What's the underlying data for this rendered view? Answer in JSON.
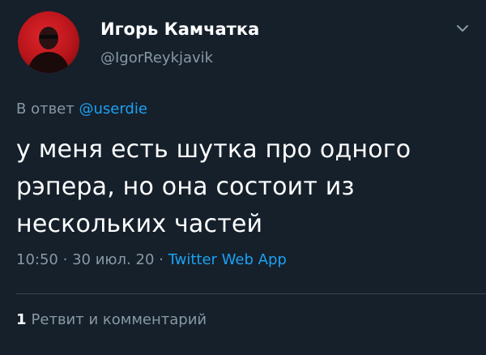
{
  "author": {
    "display_name": "Игорь Камчатка",
    "handle": "@IgorReykjavik",
    "avatar_icon": "profile-photo"
  },
  "reply": {
    "prefix": "В ответ",
    "mention": "@userdie"
  },
  "tweet": {
    "text": "у меня есть шутка про одного\nрэпера, но она состоит из\nнескольких частей"
  },
  "meta": {
    "time": "10:50",
    "separator": "·",
    "date": "30 июл. 20",
    "source": "Twitter Web App"
  },
  "stats": {
    "retweet_count": "1",
    "retweet_label": "Ретвит и комментарий"
  },
  "colors": {
    "background": "#15202b",
    "text": "#ffffff",
    "muted": "#8899a6",
    "accent": "#1da1f2"
  }
}
